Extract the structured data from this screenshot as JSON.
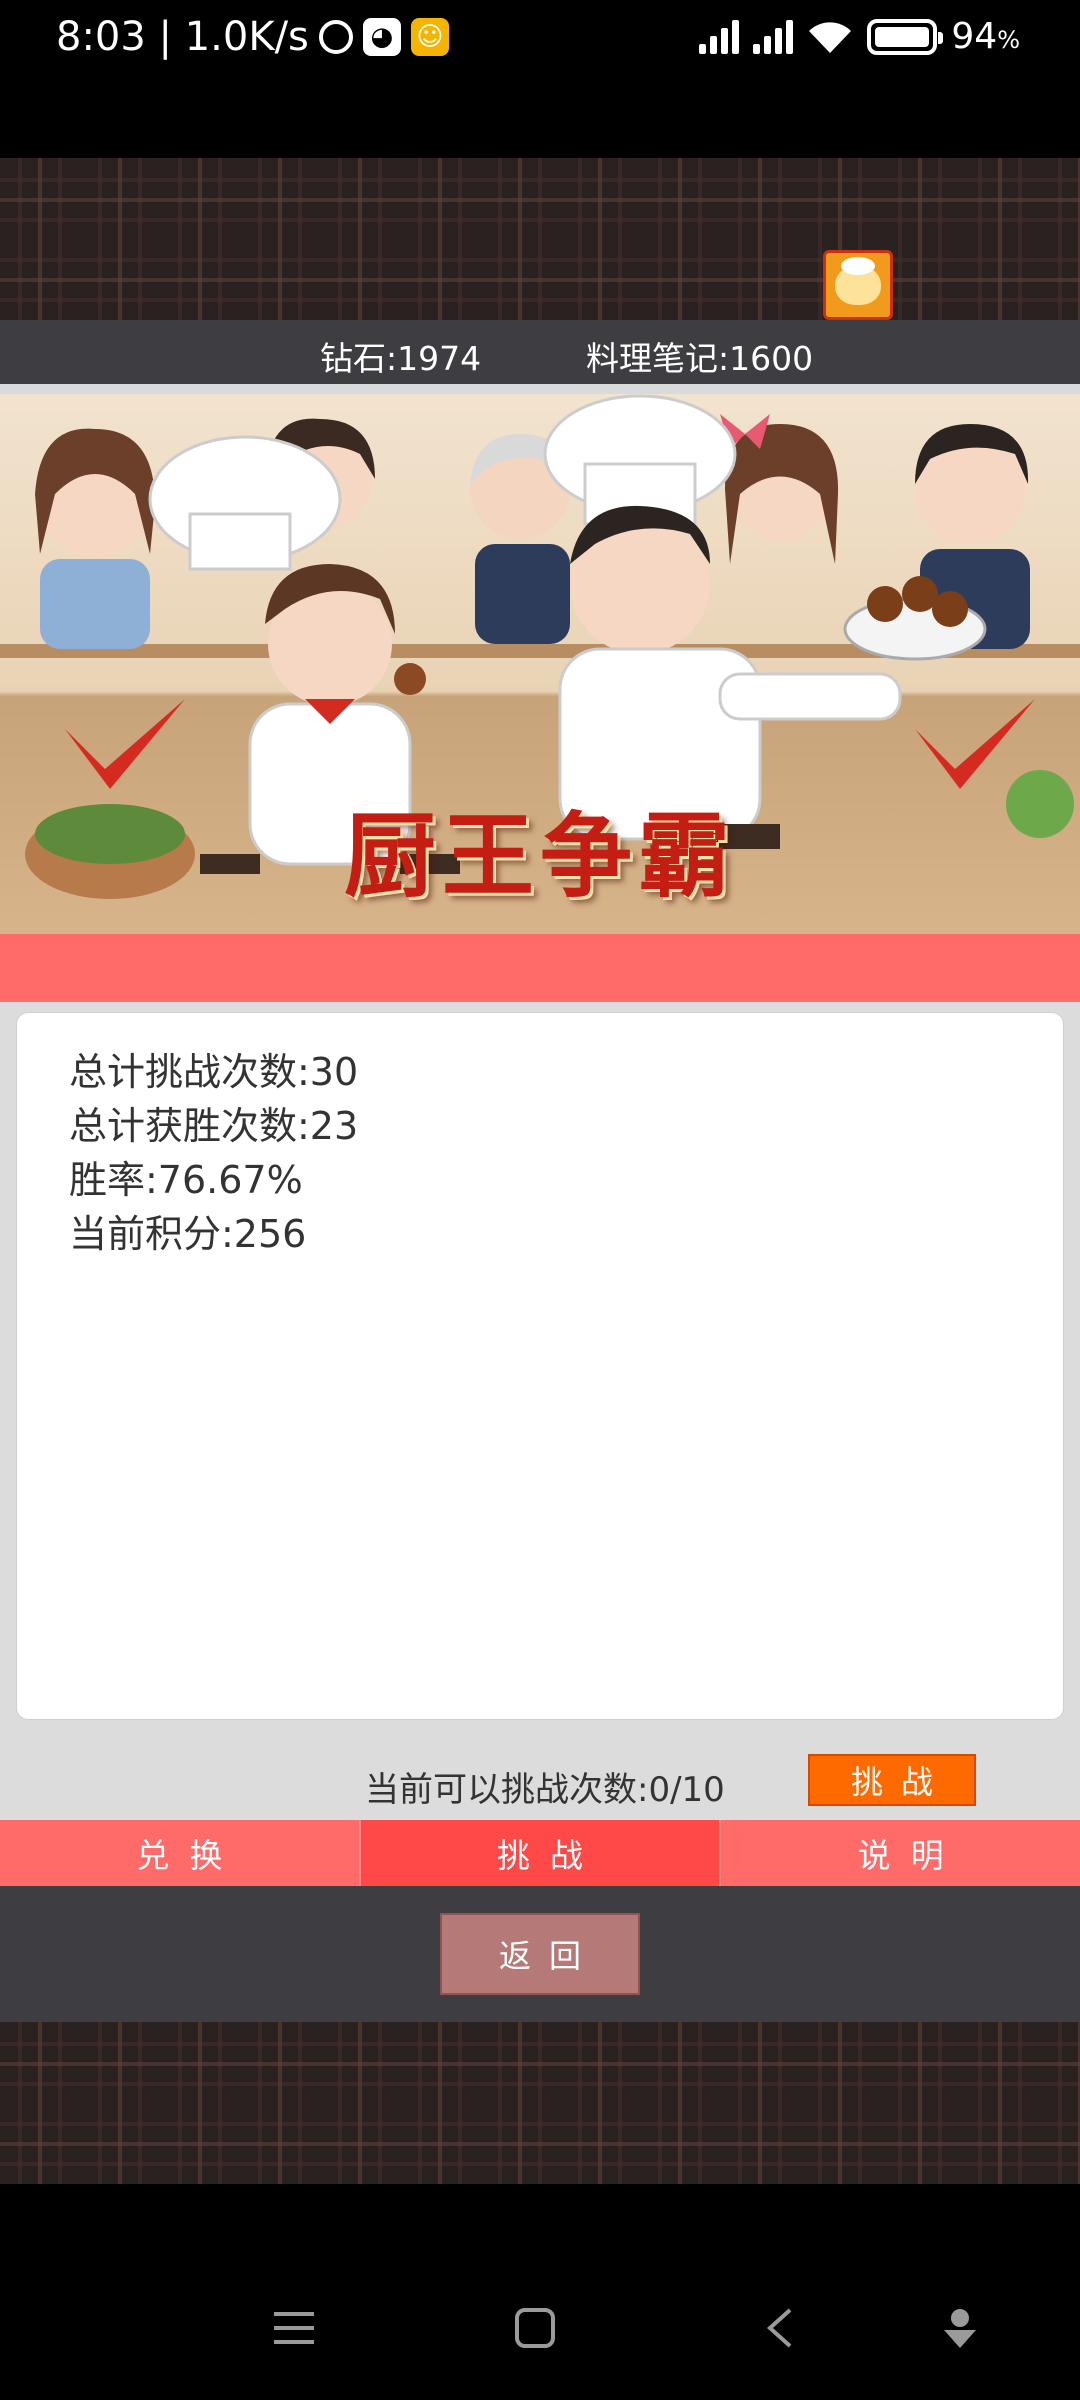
{
  "status_bar": {
    "time_speed": "8:03 | 1.0K/s",
    "battery_percent": "94",
    "battery_unit": "%"
  },
  "currency": {
    "diamonds": "钻石:1974",
    "cooking_notes": "料理笔记:1600"
  },
  "banner": {
    "title": "厨王争霸"
  },
  "stats": {
    "total_challenges": "总计挑战次数:30",
    "total_wins": "总计获胜次数:23",
    "win_rate": "胜率:76.67%",
    "current_points": "当前积分:256"
  },
  "challenge": {
    "remaining_text": "当前可以挑战次数:0/10",
    "button_label": "挑战"
  },
  "tabs": [
    {
      "label": "兑换",
      "active": false
    },
    {
      "label": "挑战",
      "active": true
    },
    {
      "label": "说明",
      "active": false
    }
  ],
  "back_button": "返回",
  "colors": {
    "accent_red": "#ff6b68",
    "active_tab": "#ff4848",
    "challenge_orange": "#ff6a00",
    "dark_bar": "#3e3e42"
  },
  "icons": [
    "alarm-icon",
    "qq-icon",
    "app-icon",
    "signal-icon",
    "wifi-icon",
    "battery-icon",
    "rice-bowl-icon",
    "menu-icon",
    "home-icon",
    "back-icon",
    "assistant-icon"
  ]
}
